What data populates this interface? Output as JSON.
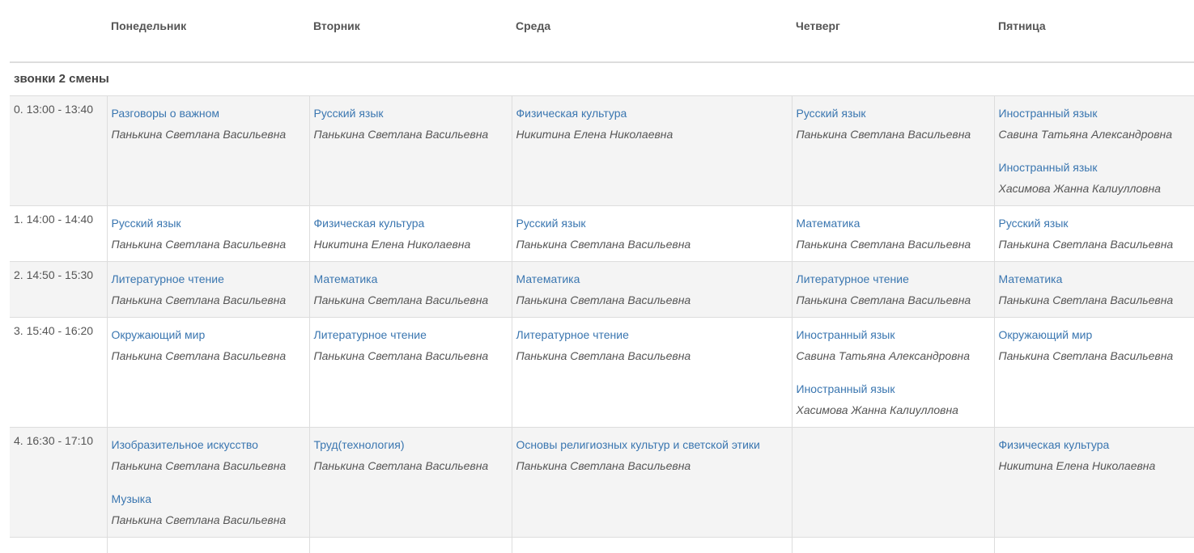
{
  "days": [
    "Понедельник",
    "Вторник",
    "Среда",
    "Четверг",
    "Пятница"
  ],
  "shift_title": "звонки 2 смены",
  "rows": [
    {
      "time": "0. 13:00 - 13:40",
      "cells": [
        [
          {
            "subject": "Разговоры о важном",
            "teacher": "Панькина Светлана Васильевна"
          }
        ],
        [
          {
            "subject": "Русский язык",
            "teacher": "Панькина Светлана Васильевна"
          }
        ],
        [
          {
            "subject": "Физическая культура",
            "teacher": "Никитина Елена Николаевна"
          }
        ],
        [
          {
            "subject": "Русский язык",
            "teacher": "Панькина Светлана Васильевна"
          }
        ],
        [
          {
            "subject": "Иностранный язык",
            "teacher": "Савина Татьяна Александровна"
          },
          {
            "subject": "Иностранный язык",
            "teacher": "Хасимова Жанна Калиулловна"
          }
        ]
      ]
    },
    {
      "time": "1. 14:00 - 14:40",
      "cells": [
        [
          {
            "subject": "Русский язык",
            "teacher": "Панькина Светлана Васильевна"
          }
        ],
        [
          {
            "subject": "Физическая культура",
            "teacher": "Никитина Елена Николаевна"
          }
        ],
        [
          {
            "subject": "Русский язык",
            "teacher": "Панькина Светлана Васильевна"
          }
        ],
        [
          {
            "subject": "Математика",
            "teacher": "Панькина Светлана Васильевна"
          }
        ],
        [
          {
            "subject": "Русский язык",
            "teacher": "Панькина Светлана Васильевна"
          }
        ]
      ]
    },
    {
      "time": "2. 14:50 - 15:30",
      "cells": [
        [
          {
            "subject": "Литературное чтение",
            "teacher": "Панькина Светлана Васильевна"
          }
        ],
        [
          {
            "subject": "Математика",
            "teacher": "Панькина Светлана Васильевна"
          }
        ],
        [
          {
            "subject": "Математика",
            "teacher": "Панькина Светлана Васильевна"
          }
        ],
        [
          {
            "subject": "Литературное чтение",
            "teacher": "Панькина Светлана Васильевна"
          }
        ],
        [
          {
            "subject": "Математика",
            "teacher": "Панькина Светлана Васильевна"
          }
        ]
      ]
    },
    {
      "time": "3. 15:40 - 16:20",
      "cells": [
        [
          {
            "subject": "Окружающий мир",
            "teacher": "Панькина Светлана Васильевна"
          }
        ],
        [
          {
            "subject": "Литературное чтение",
            "teacher": "Панькина Светлана Васильевна"
          }
        ],
        [
          {
            "subject": "Литературное чтение",
            "teacher": "Панькина Светлана Васильевна"
          }
        ],
        [
          {
            "subject": "Иностранный язык",
            "teacher": "Савина Татьяна Александровна"
          },
          {
            "subject": "Иностранный язык",
            "teacher": "Хасимова Жанна Калиулловна"
          }
        ],
        [
          {
            "subject": "Окружающий мир",
            "teacher": "Панькина Светлана Васильевна"
          }
        ]
      ]
    },
    {
      "time": "4. 16:30 - 17:10",
      "cells": [
        [
          {
            "subject": "Изобразительное искусство",
            "teacher": "Панькина Светлана Васильевна"
          },
          {
            "subject": "Музыка",
            "teacher": "Панькина Светлана Васильевна"
          }
        ],
        [
          {
            "subject": "Труд(технология)",
            "teacher": "Панькина Светлана Васильевна"
          }
        ],
        [
          {
            "subject": "Основы религиозных культур и светской этики",
            "teacher": "Панькина Светлана Васильевна"
          }
        ],
        [],
        [
          {
            "subject": "Физическая культура",
            "teacher": "Никитина Елена Николаевна"
          }
        ]
      ]
    },
    {
      "time": "",
      "cells": [
        [],
        [],
        [],
        [],
        []
      ]
    }
  ]
}
